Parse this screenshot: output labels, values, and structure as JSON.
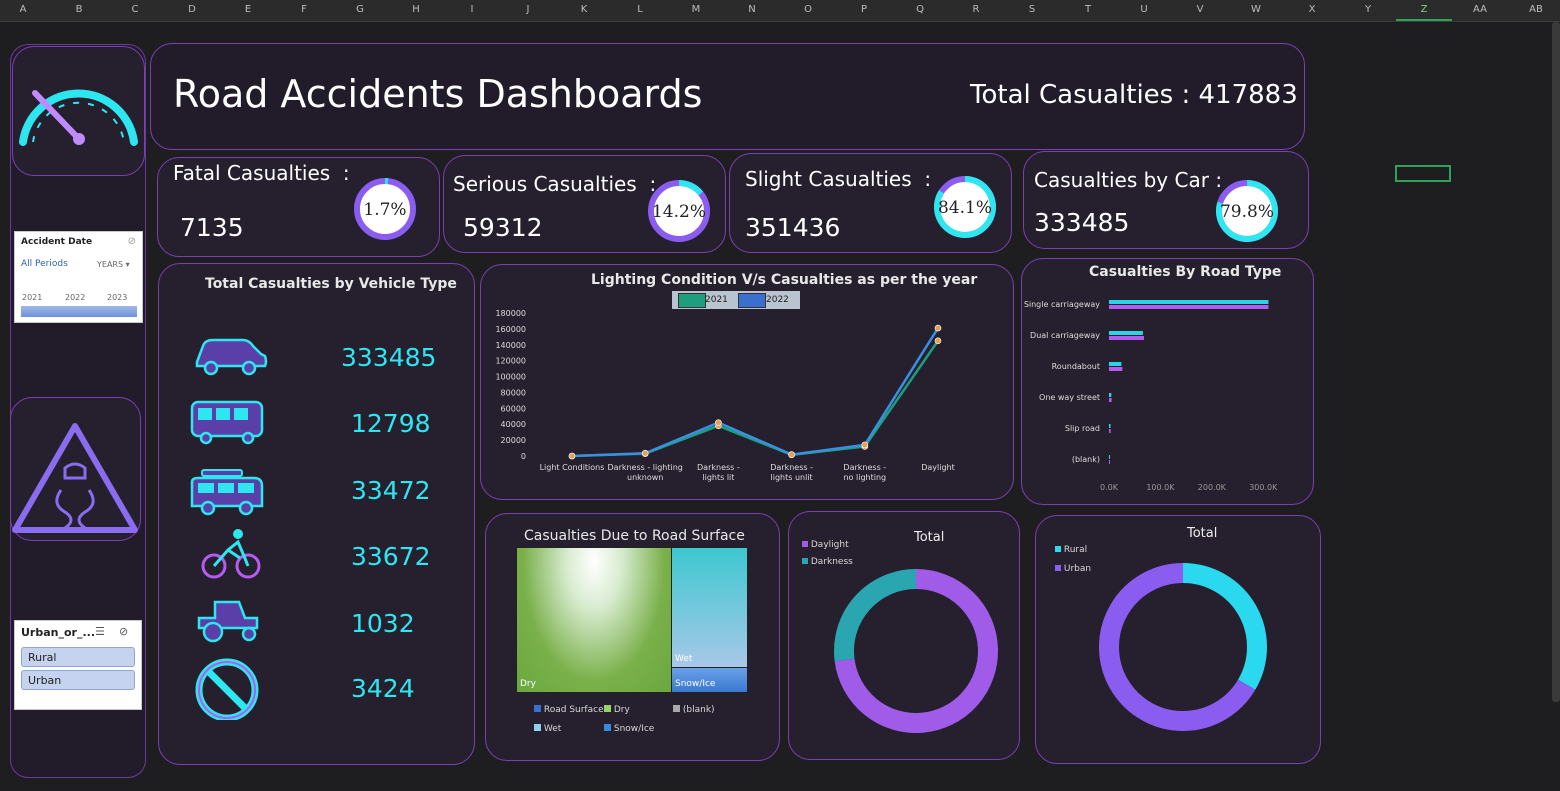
{
  "columns": [
    "A",
    "B",
    "C",
    "D",
    "E",
    "F",
    "G",
    "H",
    "I",
    "J",
    "K",
    "L",
    "M",
    "N",
    "O",
    "P",
    "Q",
    "R",
    "S",
    "T",
    "U",
    "V",
    "W",
    "X",
    "Y",
    "Z",
    "AA",
    "AB"
  ],
  "header": {
    "title": "Road Accidents Dashboards",
    "total_label": "Total Casualties",
    "total_sep": ":",
    "total_value": "417883"
  },
  "kpis": [
    {
      "label": "Fatal Casualties",
      "sep": ":",
      "value": "7135",
      "pct": "1.7%",
      "fraction": 0.017
    },
    {
      "label": "Serious Casualties",
      "sep": ":",
      "value": "59312",
      "pct": "14.2%",
      "fraction": 0.142
    },
    {
      "label": "Slight Casualties",
      "sep": ":",
      "value": "351436",
      "pct": "84.1%",
      "fraction": 0.841
    },
    {
      "label": "Casualties by Car",
      "sep": ":",
      "value": "333485",
      "pct": "79.8%",
      "fraction": 0.798
    }
  ],
  "date_slicer": {
    "title": "Accident Date",
    "period": "All Periods",
    "unit": "YEARS",
    "years": [
      "2021",
      "2022",
      "2023"
    ]
  },
  "area_slicer": {
    "title": "Urban_or_...",
    "items": [
      "Rural",
      "Urban"
    ]
  },
  "vehicles": {
    "title": "Total Casualties by Vehicle Type",
    "items": [
      {
        "icon": "car-icon",
        "value": "333485"
      },
      {
        "icon": "bus-icon",
        "value": "12798"
      },
      {
        "icon": "van-icon",
        "value": "33472"
      },
      {
        "icon": "bicycle-icon",
        "value": "33672"
      },
      {
        "icon": "tractor-icon",
        "value": "1032"
      },
      {
        "icon": "no-entry-icon",
        "value": "3424"
      }
    ]
  },
  "chart_data": [
    {
      "type": "line",
      "title": "Lighting Condition V/s Casualties as per the year",
      "categories": [
        "Light Conditions",
        "Darkness - lighting unknown",
        "Darkness - lights lit",
        "Darkness - lights unlit",
        "Darkness - no lighting",
        "Daylight"
      ],
      "series": [
        {
          "name": "2021",
          "color": "#1e9e7e",
          "values": [
            0,
            3000,
            38000,
            1500,
            12000,
            145000
          ]
        },
        {
          "name": "2022",
          "color": "#3a8fe0",
          "values": [
            0,
            3500,
            42000,
            1800,
            14000,
            161000
          ]
        }
      ],
      "ylim": [
        0,
        180000
      ],
      "yticks": [
        "180000",
        "160000",
        "140000",
        "120000",
        "100000",
        "80000",
        "60000",
        "40000",
        "20000",
        "0"
      ],
      "legend": "top"
    },
    {
      "type": "bar",
      "orientation": "horizontal",
      "title": "Casualties By Road Type",
      "categories": [
        "Single carriageway",
        "Dual carriageway",
        "Roundabout",
        "One way street",
        "Slip road",
        "(blank)"
      ],
      "series": [
        {
          "color": "#2ad4e6",
          "values": [
            310000,
            66000,
            24000,
            4500,
            3000,
            500
          ]
        },
        {
          "color": "#b45cf0",
          "values": [
            310000,
            68000,
            26000,
            5000,
            3200,
            600
          ]
        }
      ],
      "xlim": [
        0,
        350000
      ],
      "xticks": [
        "0.0K",
        "100.0K",
        "200.0K",
        "300.0K"
      ]
    },
    {
      "type": "treemap",
      "title": "Casualties Due to Road Surface",
      "items": [
        {
          "name": "Dry",
          "value": 279445
        },
        {
          "name": "Wet",
          "value": 115261
        },
        {
          "name": "Snow/Ice",
          "value": 23177
        }
      ],
      "legend": [
        "Road Surface",
        "Dry",
        "(blank)",
        "Wet",
        "Snow/Ice"
      ]
    },
    {
      "type": "pie",
      "title": "Total",
      "labels": [
        "Daylight",
        "Darkness"
      ],
      "values": [
        305033,
        112850
      ],
      "colors": [
        "#a05ce8",
        "#2aa6b0"
      ]
    },
    {
      "type": "pie",
      "title": "Total",
      "labels": [
        "Rural",
        "Urban"
      ],
      "values": [
        140000,
        277883
      ],
      "colors": [
        "#2ad8f0",
        "#8b5cf0"
      ]
    }
  ],
  "colors": {
    "accent_cyan": "#2ee6f0",
    "accent_purple": "#8a4fe6",
    "card_border": "#7b3fb4",
    "background": "#1e1e21"
  }
}
